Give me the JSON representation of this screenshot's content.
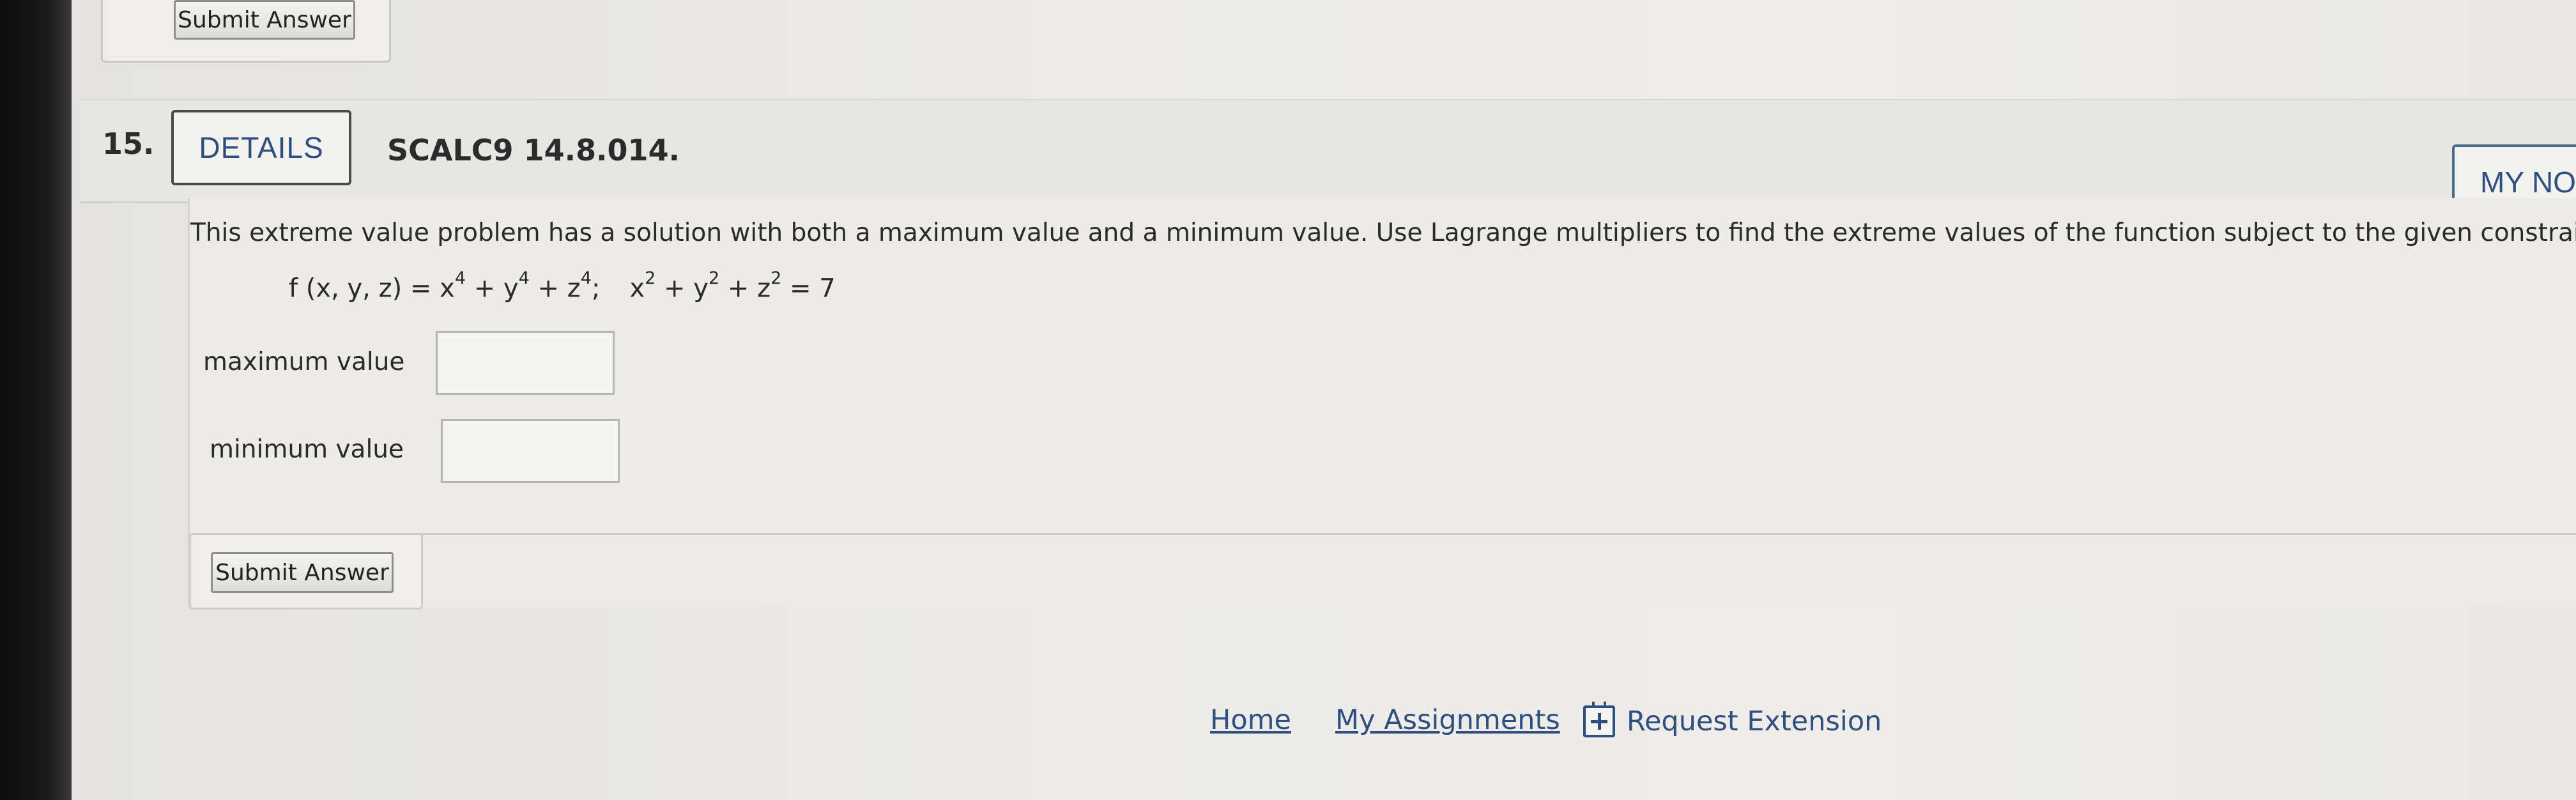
{
  "previous": {
    "submit_label": "Submit Answer"
  },
  "question": {
    "number": "15.",
    "details_label": "DETAILS",
    "code": "SCALC9 14.8.014.",
    "my_notes_label": "MY NO",
    "prompt": "This extreme value problem has a solution with both a maximum value and a minimum value. Use Lagrange multipliers to find the extreme values of the function subject to the given constraint.",
    "formula": {
      "function_lhs": "f (x, y, z) = x",
      "f_exp1": "4",
      "f_plus1": " + y",
      "f_exp2": "4",
      "f_plus2": " + z",
      "f_exp3": "4",
      "f_end": ";",
      "constraint_x": "x",
      "c_exp1": "2",
      "c_plus1": " + y",
      "c_exp2": "2",
      "c_plus2": " + z",
      "c_exp3": "2",
      "c_rhs": " = 7"
    },
    "fields": {
      "max_label": "maximum value",
      "max_value": "",
      "min_label": "minimum value",
      "min_value": ""
    },
    "submit_label": "Submit Answer"
  },
  "footer": {
    "home": "Home",
    "my_assignments": "My Assignments",
    "request_extension": "Request Extension"
  }
}
